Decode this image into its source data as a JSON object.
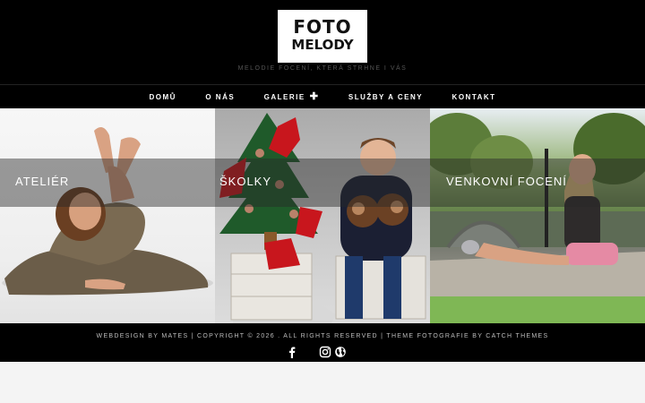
{
  "header": {
    "logo_line1": "FOTO",
    "logo_line2": "MELODY",
    "tagline": "Melodie focení, která strhne i vás"
  },
  "nav": {
    "items": [
      {
        "label": "DOMŮ"
      },
      {
        "label": "O NÁS"
      },
      {
        "label": "GALERIE",
        "icon": "plus-icon"
      },
      {
        "label": "SLUŽBY A CENY"
      },
      {
        "label": "KONTAKT"
      }
    ]
  },
  "panels": [
    {
      "label": "Ateliér"
    },
    {
      "label": "Školky"
    },
    {
      "label": "Venkovní focení"
    }
  ],
  "footer": {
    "credits": "Webdesign by Mates | Copyright © 2026 . All Rights Reserved | Theme Fotografie by Catch Themes",
    "social_icons": [
      "facebook-icon",
      "instagram-icon",
      "website-globe-icon"
    ]
  },
  "colors": {
    "background": "#000000",
    "page_bottom": "#f4f4f4",
    "text": "#ffffff",
    "accent_red": "#c8161d"
  }
}
